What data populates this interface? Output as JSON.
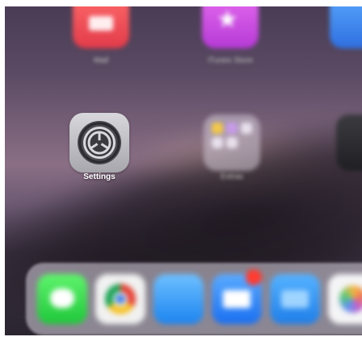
{
  "home_screen": {
    "apps": [
      {
        "name": "Mail",
        "label": "Mail",
        "blurred": true
      },
      {
        "name": "iTunes Store",
        "label": "iTunes Store",
        "blurred": true
      },
      {
        "name": "Blue App",
        "label": "",
        "blurred": true
      },
      {
        "name": "Settings",
        "label": "Settings",
        "blurred": false
      },
      {
        "name": "Folder",
        "label": "Extras",
        "blurred": true
      },
      {
        "name": "Dark App",
        "label": "",
        "blurred": true
      }
    ]
  },
  "dock": {
    "apps": [
      "messages-icon",
      "chrome-icon",
      "safari-icon",
      "mail-icon",
      "files-icon",
      "photos-icon"
    ]
  },
  "colors": {
    "badge": "#ff3b30",
    "settings_bg": "#c8c8cc"
  }
}
